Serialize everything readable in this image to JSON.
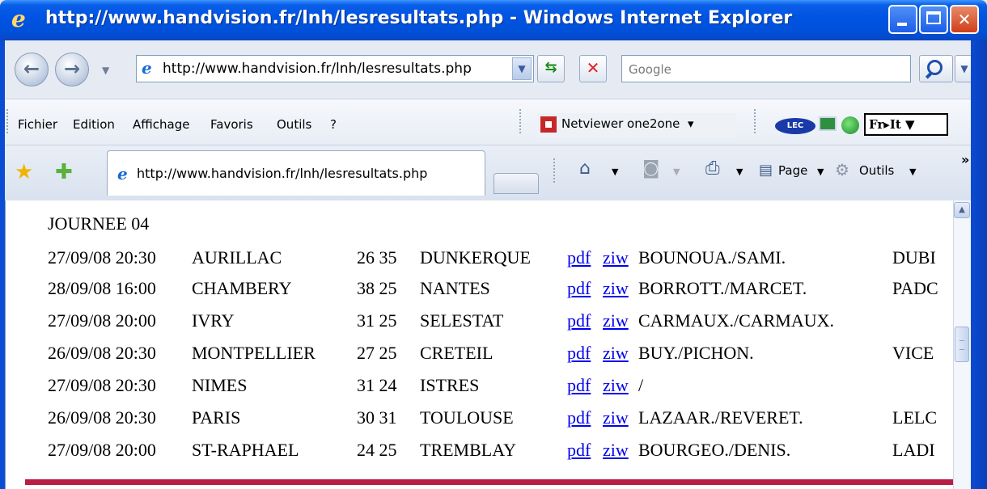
{
  "window": {
    "title": "http://www.handvision.fr/lnh/lesresultats.php - Windows Internet Explorer",
    "minimize_label": "_",
    "close_label": "✕"
  },
  "nav": {
    "back_label": "←",
    "forward_label": "→",
    "address": "http://www.handvision.fr/lnh/lesresultats.php",
    "search_placeholder": "Google"
  },
  "menu": {
    "items": [
      "Fichier",
      "Edition",
      "Affichage",
      "Favoris",
      "Outils",
      "?"
    ],
    "netviewer": "Netviewer one2one",
    "lec": "LEC",
    "frit": "Fr▸It"
  },
  "tabs": {
    "active_tab": "http://www.handvision.fr/lnh/lesresultats.php",
    "page_label": "Page",
    "tools_label": "Outils"
  },
  "content": {
    "heading": "JOURNEE 04",
    "matches": [
      {
        "date": "27/09/08 20:30",
        "home": "AURILLAC",
        "score": "26 35",
        "away": "DUNKERQUE",
        "pdf": "pdf",
        "ziw": "ziw",
        "referees": "BOUNOUA./SAMI.",
        "extra": "DUBI"
      },
      {
        "date": "28/09/08 16:00",
        "home": "CHAMBERY",
        "score": "38 25",
        "away": "NANTES",
        "pdf": "pdf",
        "ziw": "ziw",
        "referees": "BORROTT./MARCET.",
        "extra": "PADC"
      },
      {
        "date": "27/09/08 20:00",
        "home": "IVRY",
        "score": "31 25",
        "away": "SELESTAT",
        "pdf": "pdf",
        "ziw": "ziw",
        "referees": "CARMAUX./CARMAUX.",
        "extra": ""
      },
      {
        "date": "26/09/08 20:30",
        "home": "MONTPELLIER",
        "score": "27 25",
        "away": "CRETEIL",
        "pdf": "pdf",
        "ziw": "ziw",
        "referees": "BUY./PICHON.",
        "extra": "VICE"
      },
      {
        "date": "27/09/08 20:30",
        "home": "NIMES",
        "score": "31 24",
        "away": "ISTRES",
        "pdf": "pdf",
        "ziw": "ziw",
        "referees": "/",
        "extra": ""
      },
      {
        "date": "26/09/08 20:30",
        "home": "PARIS",
        "score": "30 31",
        "away": "TOULOUSE",
        "pdf": "pdf",
        "ziw": "ziw",
        "referees": "LAZAAR./REVERET.",
        "extra": "LELC"
      },
      {
        "date": "27/09/08 20:00",
        "home": "ST-RAPHAEL",
        "score": "24 25",
        "away": "TREMBLAY",
        "pdf": "pdf",
        "ziw": "ziw",
        "referees": "BOURGEO./DENIS.",
        "extra": "LADI"
      }
    ]
  }
}
